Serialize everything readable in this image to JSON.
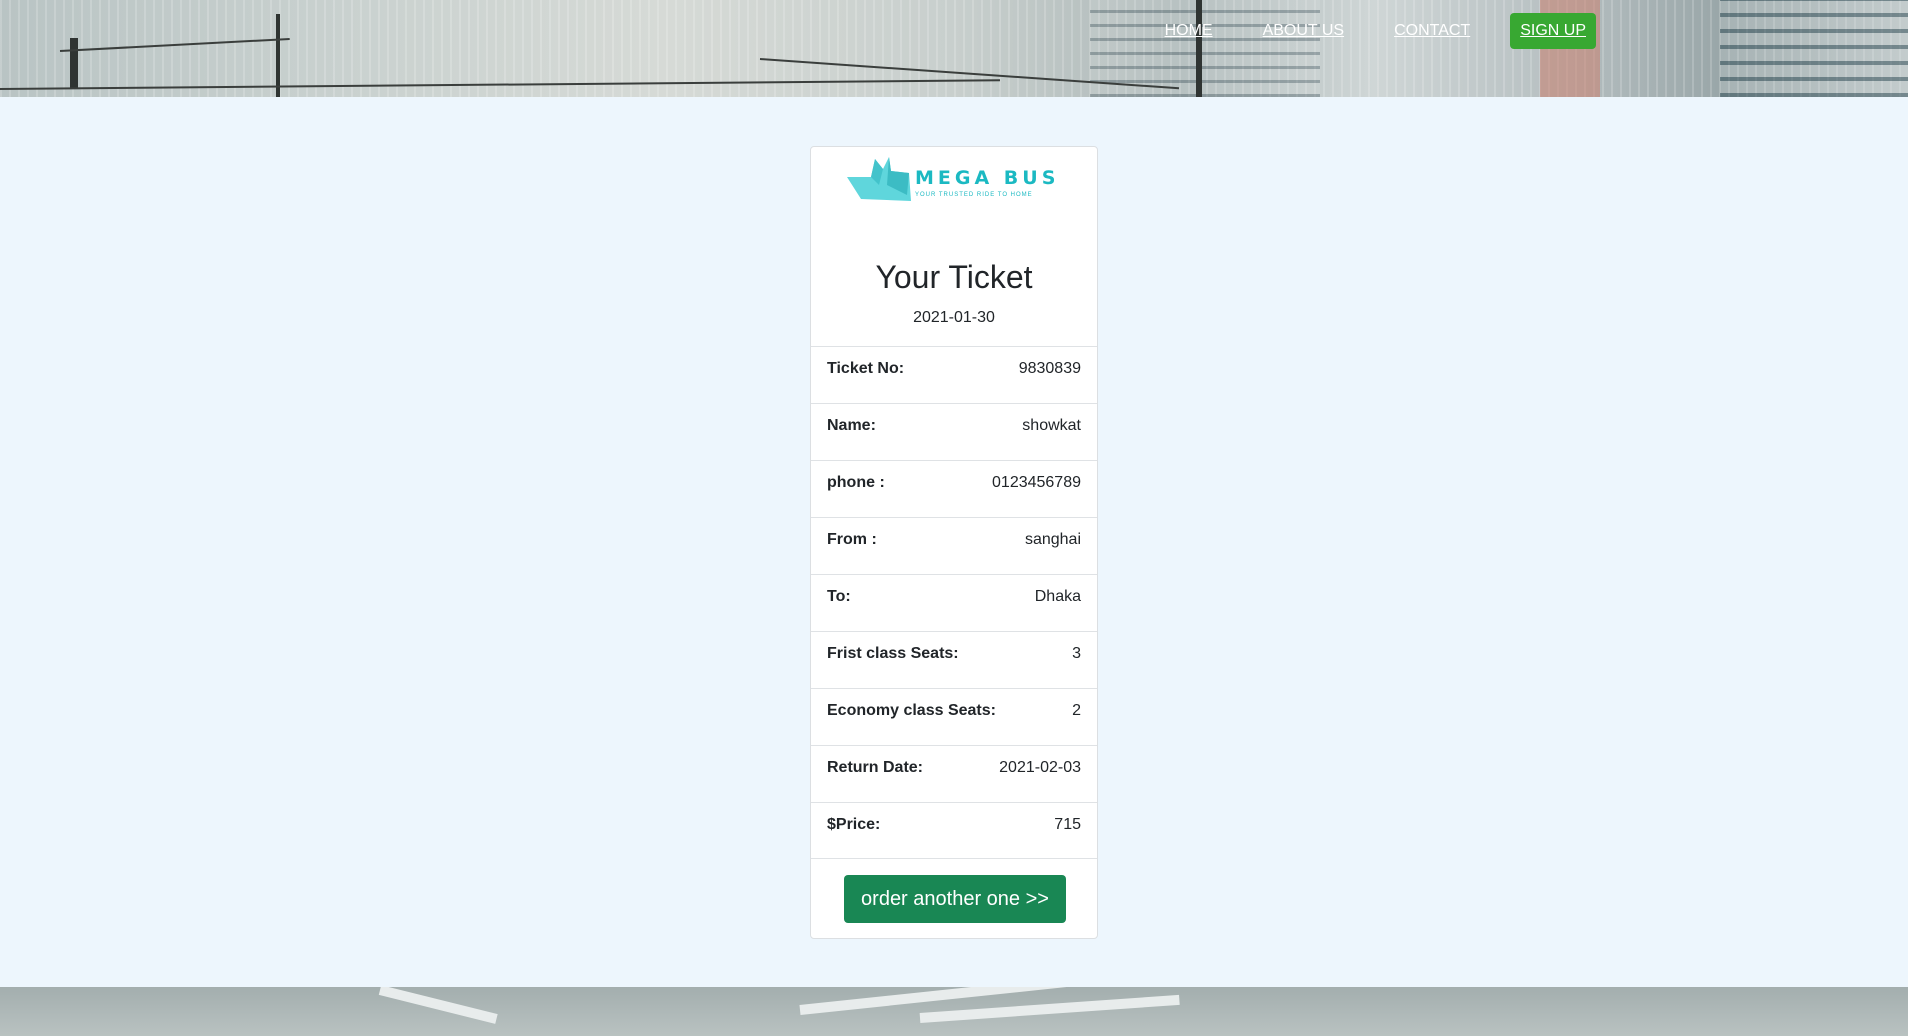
{
  "nav": {
    "items": [
      {
        "label": "HOME"
      },
      {
        "label": "ABOUT US"
      },
      {
        "label": "CONTACT"
      }
    ],
    "signup_label": "SIGN UP"
  },
  "logo": {
    "name": "MEGA BUS",
    "tagline": "YOUR TRUSTED RIDE TO HOME",
    "color": "#1bb9c2"
  },
  "ticket": {
    "title": "Your Ticket",
    "date": "2021-01-30",
    "rows": [
      {
        "label": "Ticket No:",
        "value": "9830839"
      },
      {
        "label": "Name:",
        "value": "showkat"
      },
      {
        "label": "phone :",
        "value": "0123456789"
      },
      {
        "label": "From :",
        "value": "sanghai"
      },
      {
        "label": "To:",
        "value": "Dhaka"
      },
      {
        "label": "Frist class Seats:",
        "value": "3"
      },
      {
        "label": "Economy class Seats:",
        "value": "2"
      },
      {
        "label": "Return Date:",
        "value": "2021-02-03"
      },
      {
        "label": "$Price:",
        "value": "715"
      }
    ],
    "order_button_label": "order another one >>"
  },
  "colors": {
    "page_bg": "#edf6fd",
    "signup_bg": "#38a832",
    "order_button_bg": "#198754"
  }
}
